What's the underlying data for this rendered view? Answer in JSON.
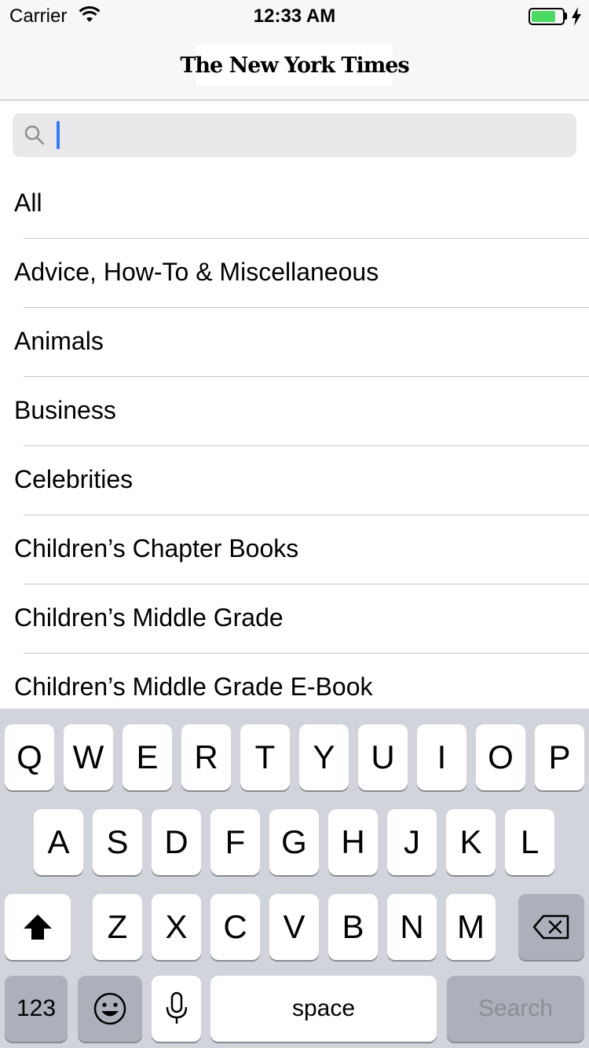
{
  "status_bar": {
    "carrier": "Carrier",
    "time": "12:33 AM",
    "battery_level": 0.8,
    "battery_color": "#4cd964"
  },
  "nav": {
    "logo_text": "The New York Times"
  },
  "search": {
    "value": "",
    "placeholder": "",
    "icon": "search-icon",
    "cursor_color": "#3478f6"
  },
  "list": {
    "items": [
      "All",
      "Advice, How-To & Miscellaneous",
      "Animals",
      "Business",
      "Celebrities",
      "Children’s Chapter Books",
      "Children’s Middle Grade",
      "Children’s Middle Grade E-Book"
    ]
  },
  "keyboard": {
    "row1": [
      "Q",
      "W",
      "E",
      "R",
      "T",
      "Y",
      "U",
      "I",
      "O",
      "P"
    ],
    "row2": [
      "A",
      "S",
      "D",
      "F",
      "G",
      "H",
      "J",
      "K",
      "L"
    ],
    "row3": [
      "Z",
      "X",
      "C",
      "V",
      "B",
      "N",
      "M"
    ],
    "shift_icon": "shift-arrow-icon",
    "delete_icon": "delete-backspace-icon",
    "numbers_label": "123",
    "emoji_icon": "emoji-icon",
    "mic_icon": "microphone-icon",
    "space_label": "space",
    "return_label": "Search"
  }
}
